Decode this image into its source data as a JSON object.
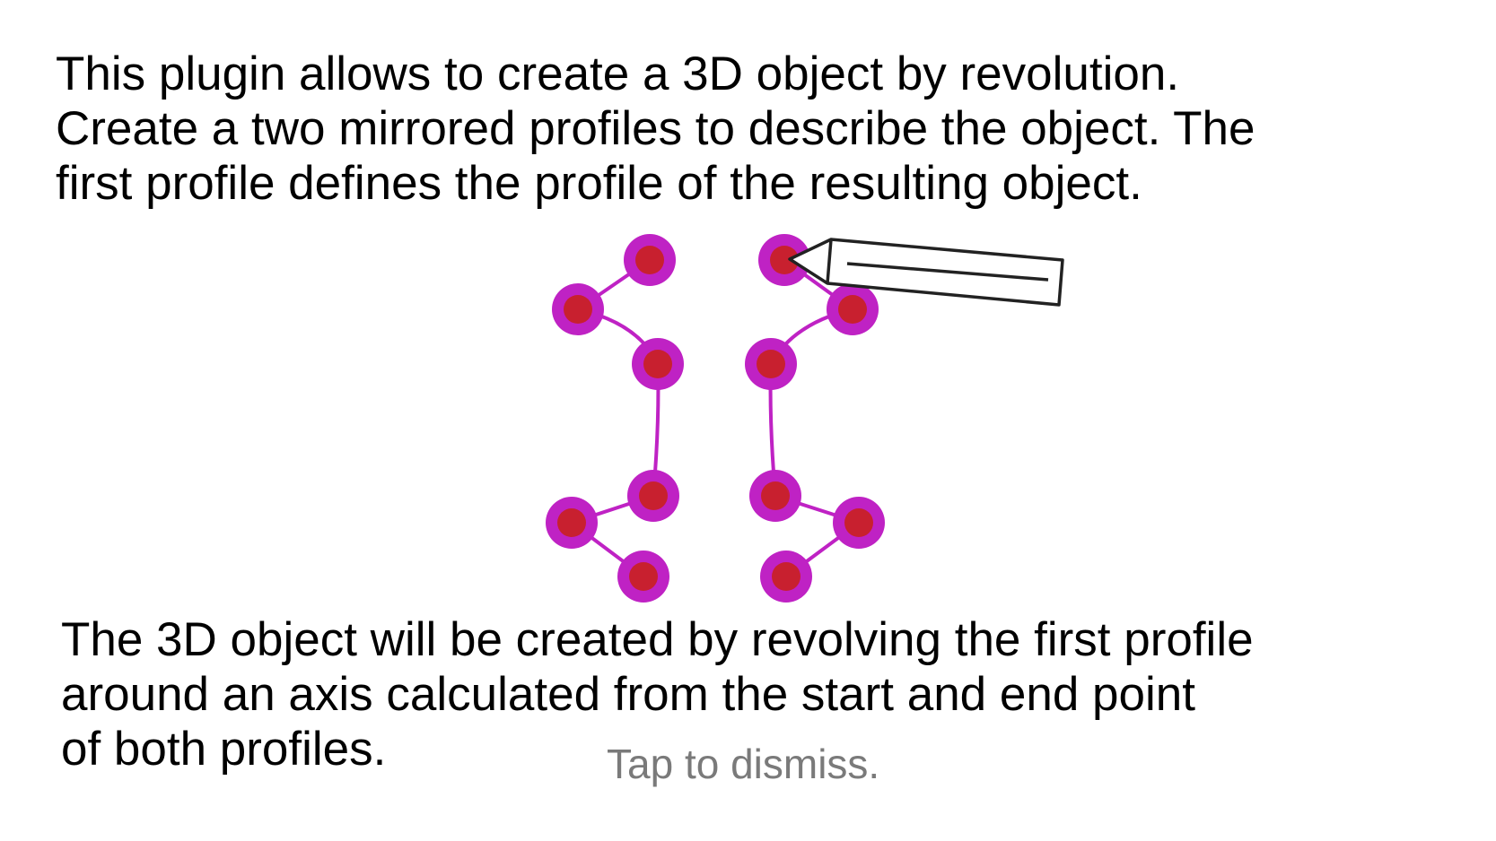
{
  "help": {
    "intro_text": "This plugin allows to create a 3D object by revolution.\nCreate a two mirrored profiles to describe the object. The\nfirst profile defines the profile of the resulting object.",
    "explanation_text": "The 3D object will be created by revolving the first profile\naround an axis calculated from the start and end point\nof both profiles.",
    "dismiss_label": "Tap to dismiss."
  },
  "illustration": {
    "point_outer_color": "#bf22c4",
    "point_inner_color": "#c8202f",
    "profile_line_color": "#bf22c4",
    "pencil_stroke_color": "#222222",
    "pencil_icon": "pencil-icon"
  }
}
